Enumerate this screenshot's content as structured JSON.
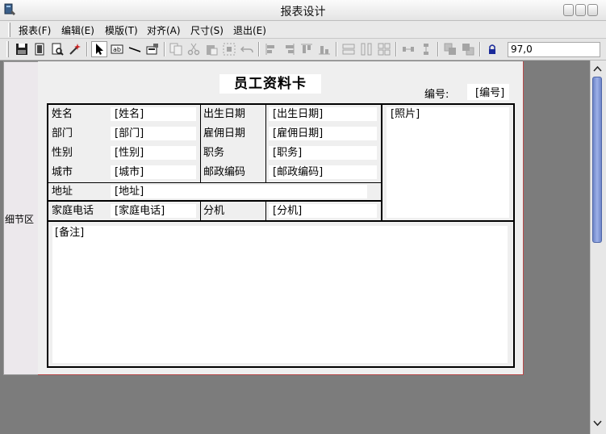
{
  "window": {
    "title": "报表设计"
  },
  "menu": [
    "报表(F)",
    "编辑(E)",
    "模版(T)",
    "对齐(A)",
    "尺寸(S)",
    "退出(E)"
  ],
  "toolbar": {
    "buttons": [
      "save-icon",
      "page-setup-icon",
      "print-preview-icon",
      "magic-wand-icon",
      "pointer-icon",
      "field-icon",
      "line-icon",
      "label-icon",
      "copy-icon",
      "cut-icon",
      "paste-icon",
      "select-all-icon",
      "undo-icon",
      "align-left-icon",
      "align-right-icon",
      "align-top-icon",
      "align-bottom-icon",
      "same-size-icon",
      "same-width-icon",
      "same-height-icon",
      "h-space-icon",
      "v-space-icon",
      "bring-front-icon",
      "send-back-icon",
      "lock-icon"
    ],
    "zoom": "97,0"
  },
  "band_label": "细节区",
  "report": {
    "title": "员工资料卡",
    "no_label": "编号:",
    "no_field": "[编号]",
    "rows": [
      {
        "label1": "姓名",
        "field1": "[姓名]",
        "label2": "出生日期",
        "field2": "[出生日期]"
      },
      {
        "label1": "部门",
        "field1": "[部门]",
        "label2": "雇佣日期",
        "field2": "[雇佣日期]"
      },
      {
        "label1": "性别",
        "field1": "[性别]",
        "label2": "职务",
        "field2": "[职务]"
      },
      {
        "label1": "城市",
        "field1": "[城市]",
        "label2": "邮政编码",
        "field2": "[邮政编码]"
      }
    ],
    "address_label": "地址",
    "address_field": "[地址]",
    "phone_label": "家庭电话",
    "phone_field": "[家庭电话]",
    "ext_label": "分机",
    "ext_field": "[分机]",
    "photo_field": "[照片]",
    "notes_field": "[备注]"
  },
  "colors": {
    "scroll_thumb": "#7f95d6",
    "workspace": "#7c7c7c",
    "design_area": "#efefef",
    "band_border": "#b84a4a"
  }
}
